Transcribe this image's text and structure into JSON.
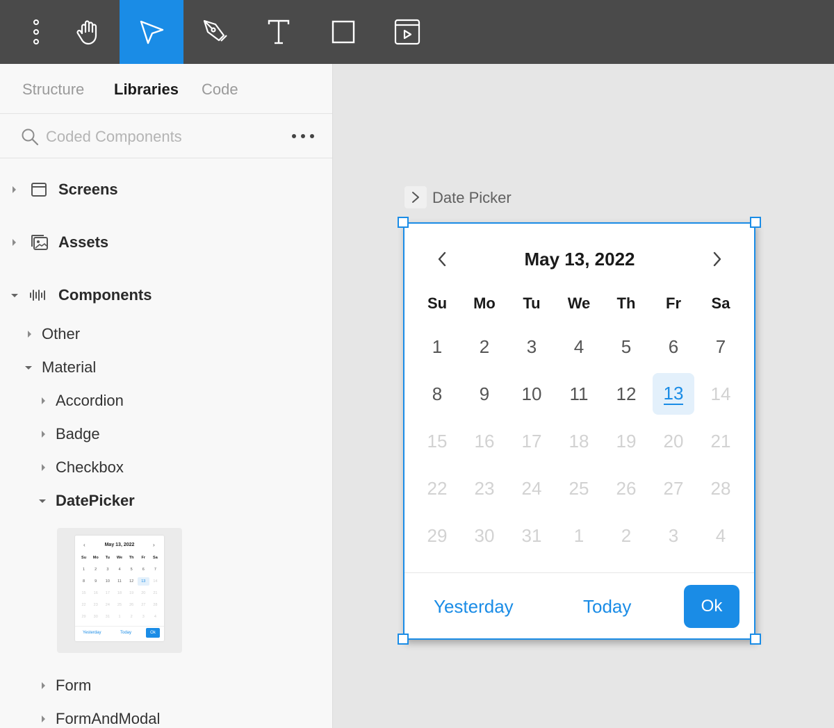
{
  "toolbar": {
    "tools": [
      {
        "name": "menu-icon",
        "active": false
      },
      {
        "name": "hand-icon",
        "active": false
      },
      {
        "name": "pointer-icon",
        "active": true
      },
      {
        "name": "pen-icon",
        "active": false
      },
      {
        "name": "text-icon",
        "active": false
      },
      {
        "name": "rectangle-icon",
        "active": false
      },
      {
        "name": "frame-play-icon",
        "active": false
      }
    ],
    "active_color": "#1a8ce6"
  },
  "sidebar": {
    "tabs": [
      {
        "label": "Structure",
        "active": false
      },
      {
        "label": "Libraries",
        "active": true
      },
      {
        "label": "Code",
        "active": false
      }
    ],
    "search": {
      "placeholder": "Coded Components",
      "value": ""
    },
    "tree": {
      "screens": "Screens",
      "assets": "Assets",
      "components": "Components",
      "other": "Other",
      "material": "Material",
      "accordion": "Accordion",
      "badge": "Badge",
      "checkbox": "Checkbox",
      "datepicker": "DatePicker",
      "form": "Form",
      "formandmodal": "FormAndModal"
    },
    "thumbnail": {
      "title": "May 13, 2022",
      "yesterday": "Yesterday",
      "today": "Today",
      "ok": "Ok"
    }
  },
  "canvas": {
    "frame_label": "Date Picker",
    "picker": {
      "title": "May 13, 2022",
      "weekdays": [
        "Su",
        "Mo",
        "Tu",
        "We",
        "Th",
        "Fr",
        "Sa"
      ],
      "weeks": [
        [
          {
            "d": "1",
            "s": "normal"
          },
          {
            "d": "2",
            "s": "normal"
          },
          {
            "d": "3",
            "s": "normal"
          },
          {
            "d": "4",
            "s": "normal"
          },
          {
            "d": "5",
            "s": "normal"
          },
          {
            "d": "6",
            "s": "normal"
          },
          {
            "d": "7",
            "s": "normal"
          }
        ],
        [
          {
            "d": "8",
            "s": "normal"
          },
          {
            "d": "9",
            "s": "normal"
          },
          {
            "d": "10",
            "s": "normal"
          },
          {
            "d": "11",
            "s": "normal"
          },
          {
            "d": "12",
            "s": "normal"
          },
          {
            "d": "13",
            "s": "selected"
          },
          {
            "d": "14",
            "s": "muted"
          }
        ],
        [
          {
            "d": "15",
            "s": "muted"
          },
          {
            "d": "16",
            "s": "muted"
          },
          {
            "d": "17",
            "s": "muted"
          },
          {
            "d": "18",
            "s": "muted"
          },
          {
            "d": "19",
            "s": "muted"
          },
          {
            "d": "20",
            "s": "muted"
          },
          {
            "d": "21",
            "s": "muted"
          }
        ],
        [
          {
            "d": "22",
            "s": "muted"
          },
          {
            "d": "23",
            "s": "muted"
          },
          {
            "d": "24",
            "s": "muted"
          },
          {
            "d": "25",
            "s": "muted"
          },
          {
            "d": "26",
            "s": "muted"
          },
          {
            "d": "27",
            "s": "muted"
          },
          {
            "d": "28",
            "s": "muted"
          }
        ],
        [
          {
            "d": "29",
            "s": "muted"
          },
          {
            "d": "30",
            "s": "muted"
          },
          {
            "d": "31",
            "s": "muted"
          },
          {
            "d": "1",
            "s": "muted"
          },
          {
            "d": "2",
            "s": "muted"
          },
          {
            "d": "3",
            "s": "muted"
          },
          {
            "d": "4",
            "s": "muted"
          }
        ]
      ],
      "yesterday_label": "Yesterday",
      "today_label": "Today",
      "ok_label": "Ok"
    }
  }
}
